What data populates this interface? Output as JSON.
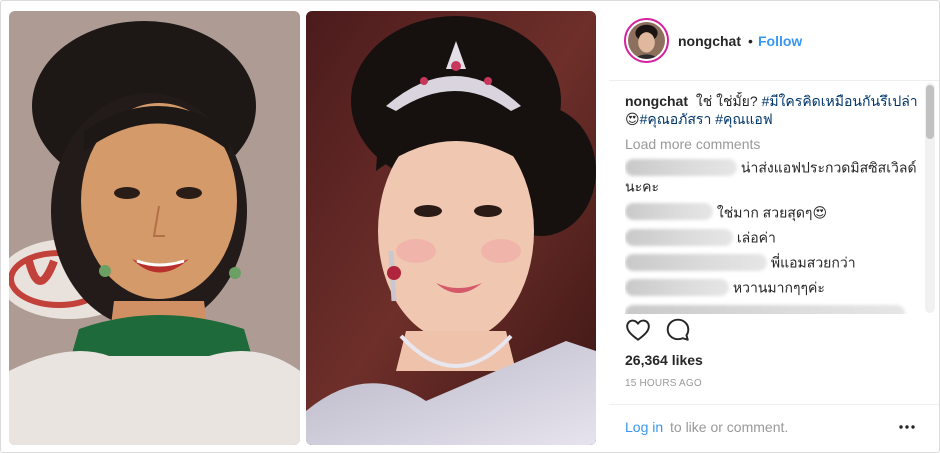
{
  "header": {
    "username": "nongchat",
    "separator": "•",
    "follow_label": "Follow"
  },
  "caption": {
    "username": "nongchat",
    "text": "ใช่ ใช่มั้ย?",
    "tag1": "#มีใครคิดเหมือนกันรึเปล่า",
    "emoji": "😍",
    "tag2": "#คุณอภัสรา",
    "tag3": "#คุณแอฟ"
  },
  "load_more_label": "Load more comments",
  "comments": [
    {
      "text": "น่าส่งแอฟประกวดมิสซิสเวิลด์นะคะ"
    },
    {
      "text": "ใช่มาก สวยสุดๆ😍"
    },
    {
      "text": "เล่อค่า"
    },
    {
      "text": "พี่แอมสวยกว่า"
    },
    {
      "text": "หวานมากๆๆค่ะ"
    },
    {
      "text": ""
    }
  ],
  "icons": {
    "like": "heart-icon",
    "comment": "comment-bubble-icon",
    "more": "more-options-icon"
  },
  "likes_label": "26,364 likes",
  "timestamp": "15 HOURS AGO",
  "footer": {
    "login_label": "Log in",
    "login_rest": "to like or comment.",
    "more_label": "•••"
  },
  "colors": {
    "accent": "#3897f0",
    "hashtag": "#003569",
    "muted": "#999999",
    "text": "#262626"
  }
}
